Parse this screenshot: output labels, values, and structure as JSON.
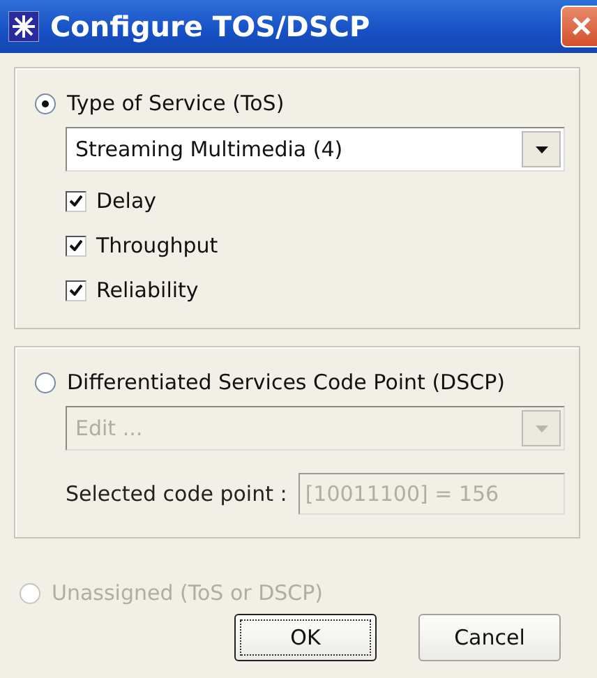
{
  "window": {
    "title": "Configure TOS/DSCP",
    "close": "✕"
  },
  "tos": {
    "label": "Type of Service (ToS)",
    "selected": true,
    "disabled": false,
    "combo": {
      "value": "Streaming Multimedia (4)",
      "disabled": false
    },
    "checkboxes": [
      {
        "label": "Delay",
        "checked": true
      },
      {
        "label": "Throughput",
        "checked": true
      },
      {
        "label": "Reliability",
        "checked": true
      }
    ]
  },
  "dscp": {
    "label": "Differentiated Services Code Point (DSCP)",
    "selected": false,
    "disabled": false,
    "combo": {
      "value": "Edit ...",
      "disabled": true
    },
    "code_point": {
      "label": "Selected code point :",
      "value": "[10011100] = 156",
      "disabled": true
    }
  },
  "unassigned": {
    "label": "Unassigned (ToS or DSCP)",
    "selected": false,
    "disabled": true
  },
  "buttons": [
    {
      "label": "OK",
      "focused": true
    },
    {
      "label": "Cancel",
      "focused": false
    }
  ]
}
